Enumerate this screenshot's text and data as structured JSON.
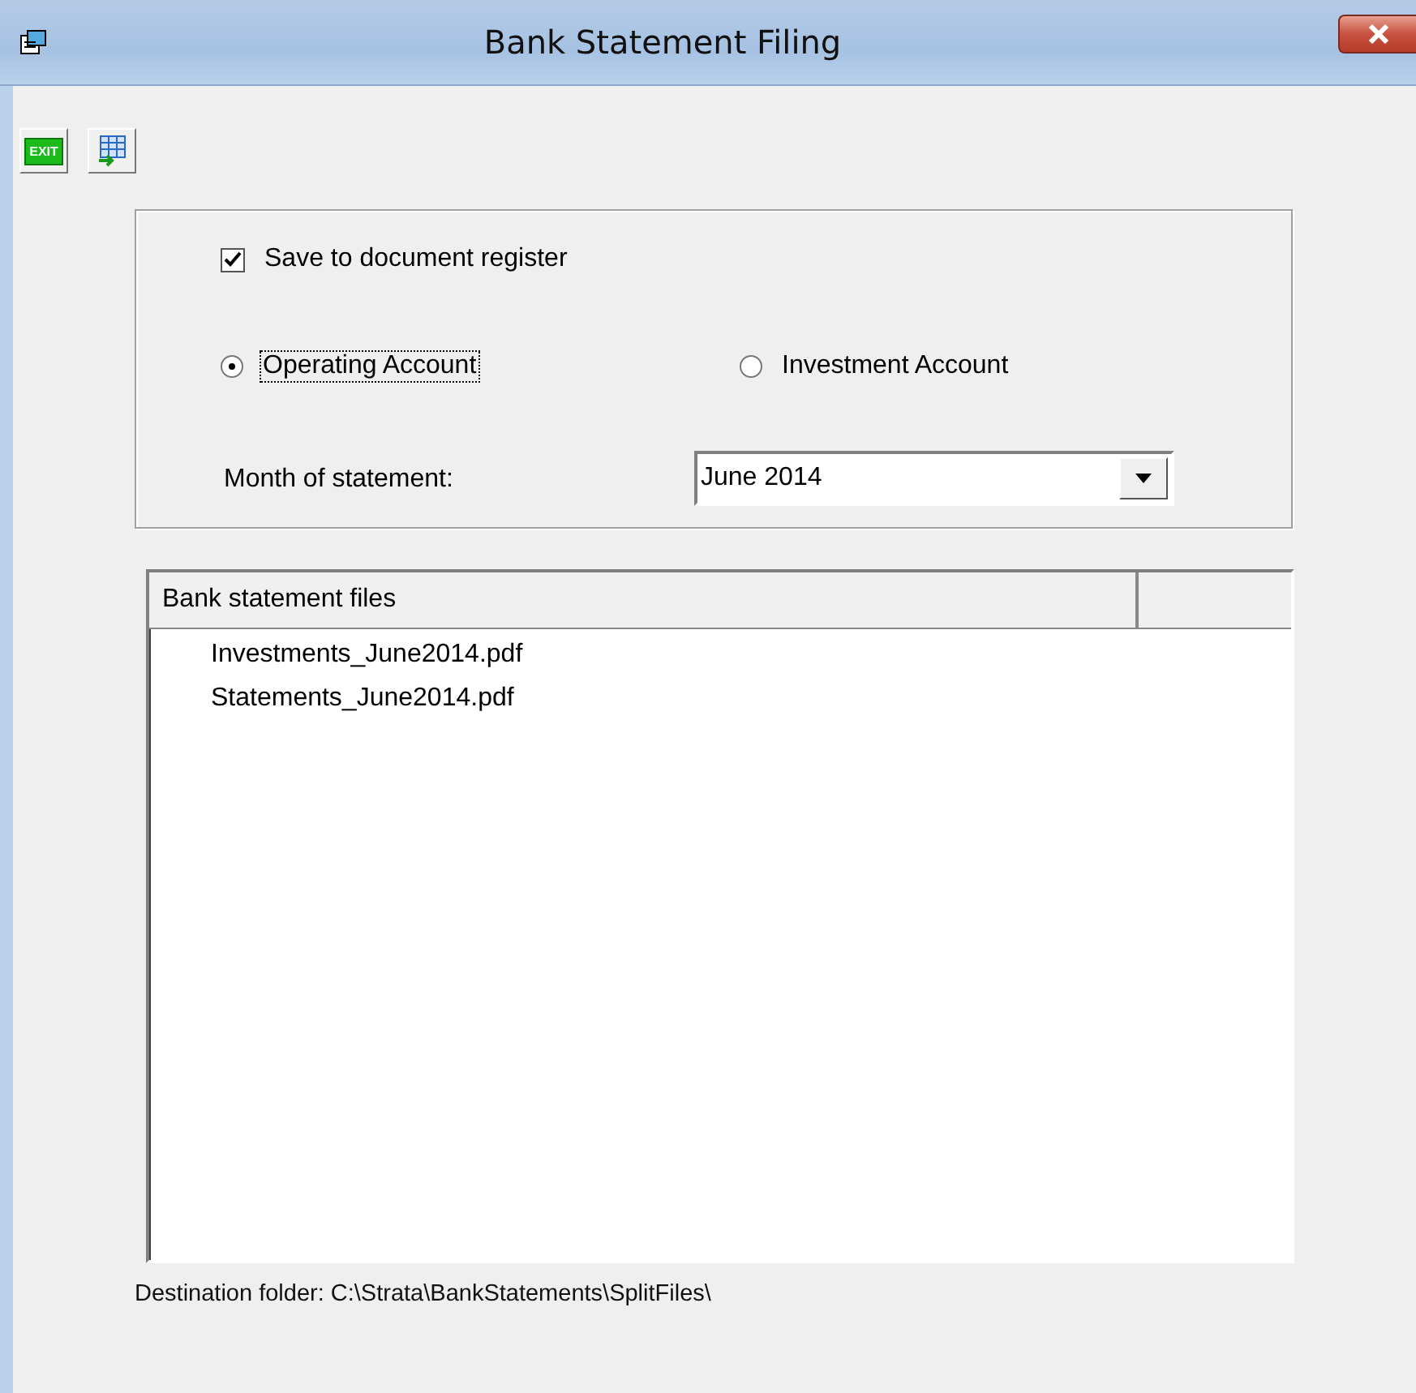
{
  "window": {
    "title": "Bank Statement Filing"
  },
  "toolbar": [
    {
      "kind": "exit",
      "label": "EXIT"
    },
    {
      "kind": "grid"
    }
  ],
  "options": {
    "save_checkbox": {
      "label": "Save to document register",
      "checked": true
    },
    "accounts": [
      {
        "label": "Operating Account",
        "selected": true,
        "focused": true
      },
      {
        "label": "Investment Account",
        "selected": false,
        "focused": false
      }
    ],
    "month": {
      "label": "Month of statement:",
      "value": "June 2014"
    }
  },
  "file_list": {
    "columns": [
      "Bank statement files"
    ],
    "rows": [
      "Investments_June2014.pdf",
      "Statements_June2014.pdf"
    ]
  },
  "status": "Destination folder: C:\\Strata\\BankStatements\\SplitFiles\\"
}
